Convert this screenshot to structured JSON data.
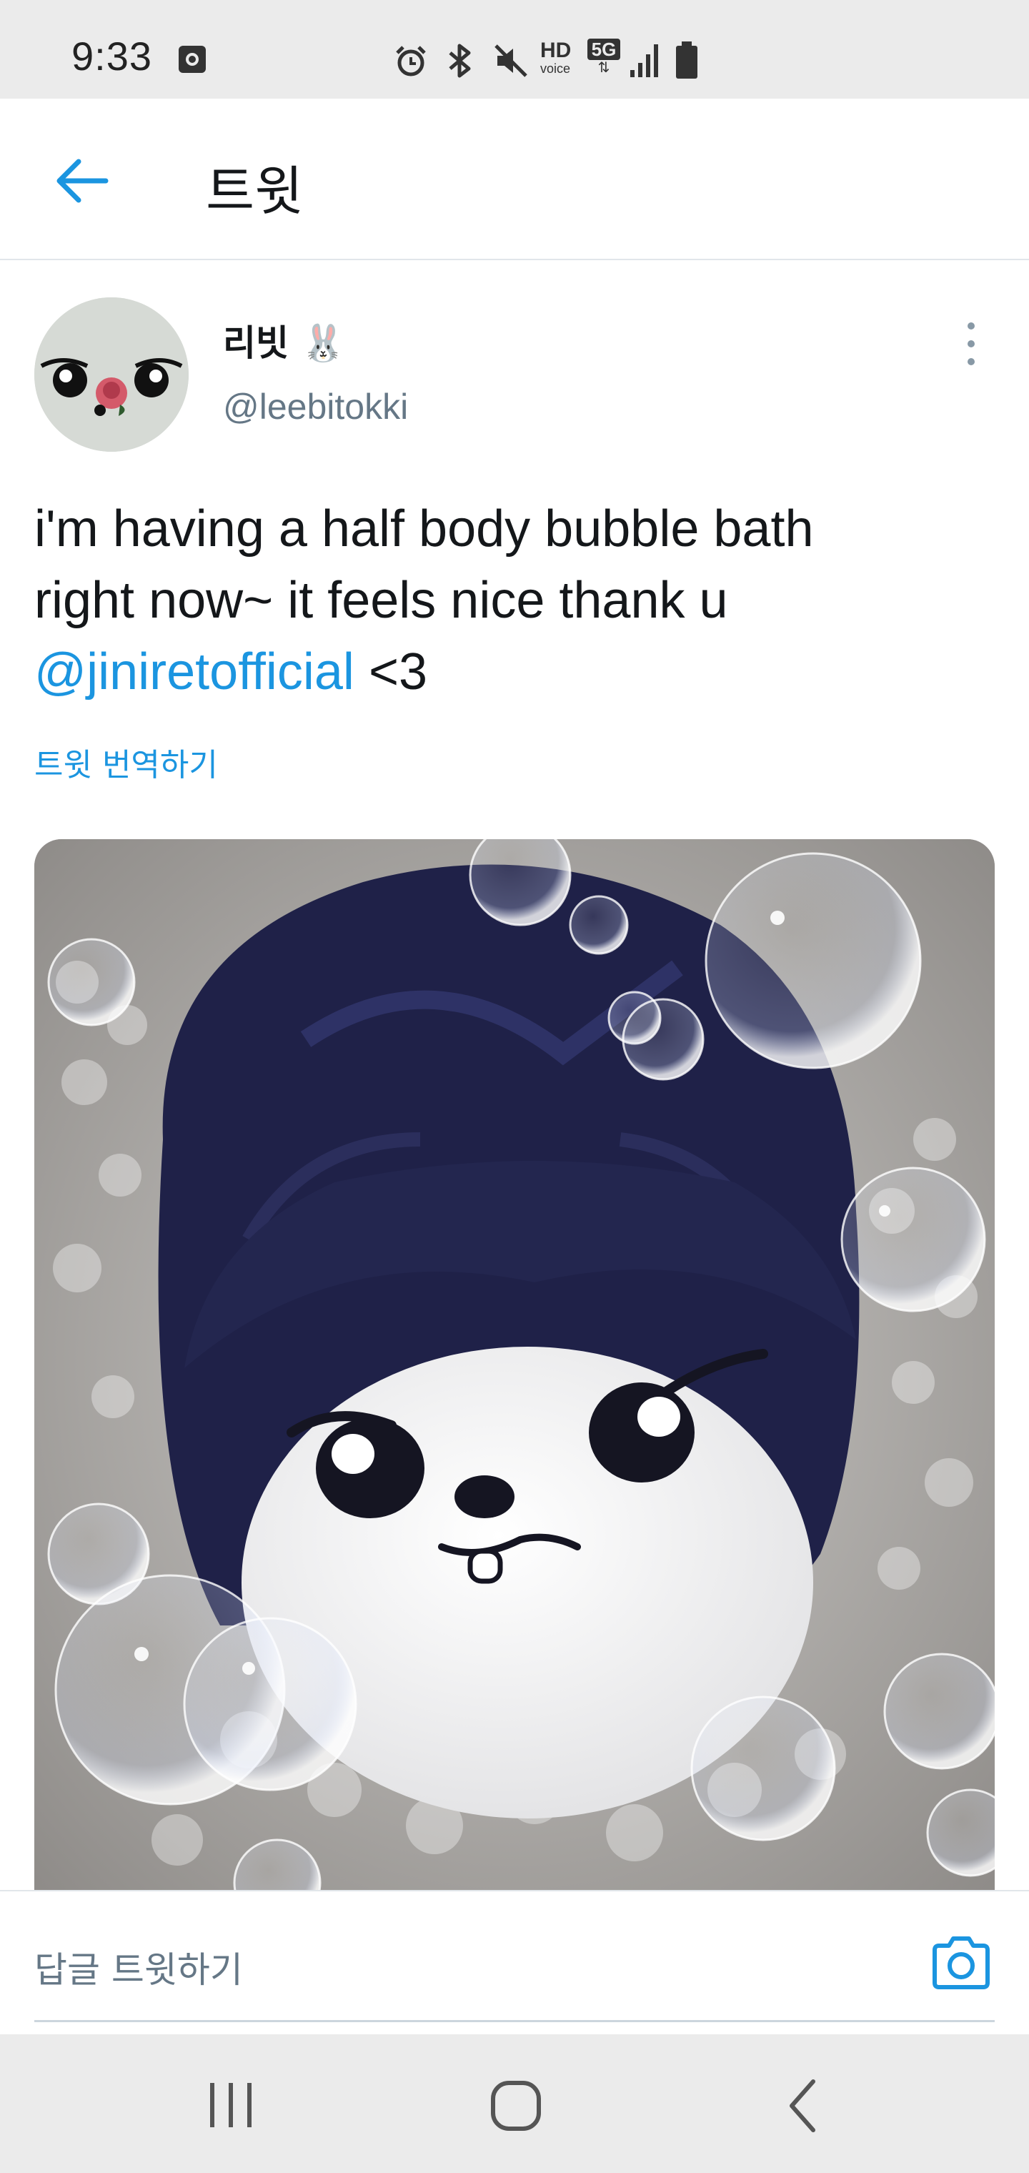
{
  "status_bar": {
    "time": "9:33",
    "icons": [
      "screen-record-icon",
      "alarm-icon",
      "bluetooth-icon",
      "mute-icon",
      "hd-voice-icon",
      "5g-icon",
      "signal-icon",
      "battery-icon"
    ],
    "hd_label": "HD",
    "voice_label": "voice",
    "network_label": "5G"
  },
  "header": {
    "title": "트윗",
    "back_icon": "arrow-left-icon"
  },
  "tweet": {
    "author_name": "리빗",
    "author_emoji": "🐰",
    "author_handle": "@leebitokki",
    "text_line1": "i'm having a half body bubble bath",
    "text_line2": "right now~ it feels nice thank u",
    "mention": "@jiniretofficial",
    "text_tail": " <3",
    "translate_label": "트윗 번역하기",
    "more_icon": "more-vertical-icon"
  },
  "reply": {
    "placeholder": "답글 트윗하기",
    "camera_icon": "camera-icon"
  },
  "nav": {
    "icons": [
      "recent-apps-icon",
      "home-icon",
      "back-icon"
    ]
  },
  "colors": {
    "accent": "#1b95e0",
    "text": "#14171a",
    "secondary": "#657786",
    "system_bar": "#ebebeb"
  }
}
